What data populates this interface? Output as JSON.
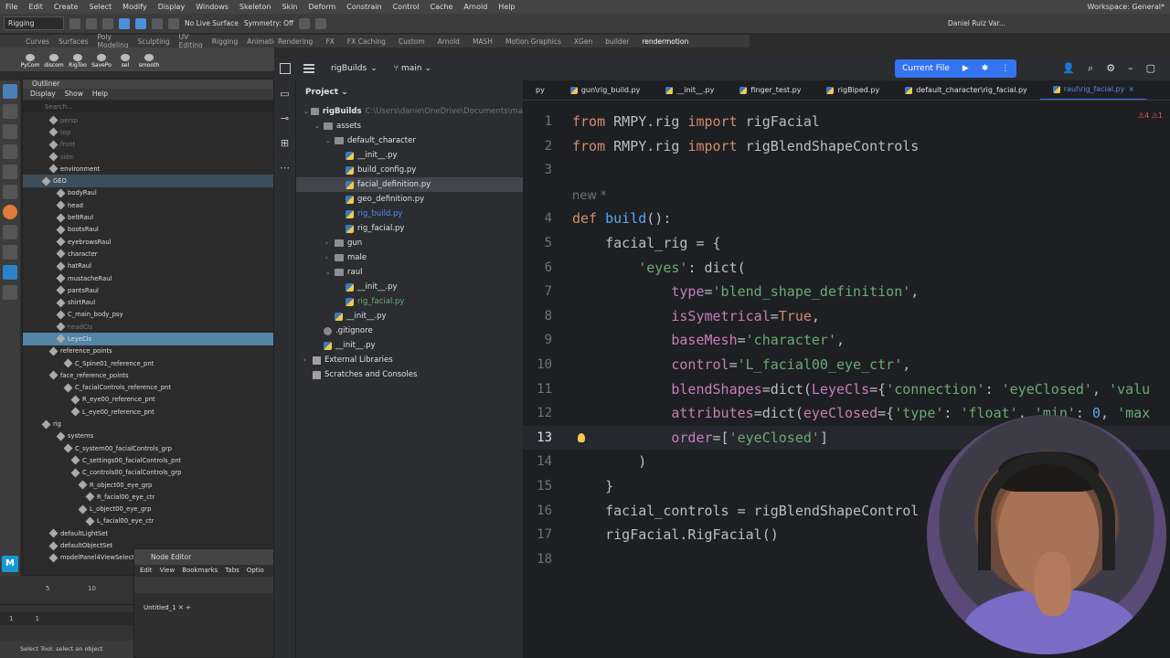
{
  "maya": {
    "menu": [
      "File",
      "Edit",
      "Create",
      "Select",
      "Modify",
      "Display",
      "Windows",
      "Skeleton",
      "Skin",
      "Deform",
      "Constrain",
      "Control",
      "Cache",
      "Arnold",
      "Help"
    ],
    "workspace": "Workspace: General*",
    "toolbar": {
      "mode": "Rigging",
      "live_surface": "No Live Surface",
      "symmetry": "Symmetry: Off",
      "user": "Daniel Ruiz Var..."
    },
    "shelf_tabs": [
      "Curves",
      "Surfaces",
      "Poly Modeling",
      "Sculpting",
      "UV Editing",
      "Rigging",
      "Animation",
      "Rendering",
      "FX",
      "FX Caching",
      "Custom",
      "Arnold",
      "MASH",
      "Motion Graphics",
      "XGen",
      "builder",
      "rendermotion"
    ],
    "shelf_buttons": [
      "PyCom",
      "discom",
      "RigToo",
      "SavePo",
      "sel",
      "smooth"
    ],
    "outliner": {
      "title": "Outliner",
      "menu": [
        "Display",
        "Show",
        "Help"
      ],
      "search_placeholder": "Search...",
      "rows": [
        {
          "label": "persp",
          "dim": true,
          "indent": 3
        },
        {
          "label": "top",
          "dim": true,
          "indent": 3
        },
        {
          "label": "front",
          "dim": true,
          "indent": 3
        },
        {
          "label": "side",
          "dim": true,
          "indent": 3
        },
        {
          "label": "environment",
          "indent": 3
        },
        {
          "label": "GEO",
          "indent": 2,
          "hl": true
        },
        {
          "label": "bodyRaul",
          "indent": 4
        },
        {
          "label": "head",
          "indent": 4
        },
        {
          "label": "beltRaul",
          "indent": 4
        },
        {
          "label": "bootsRaul",
          "indent": 4
        },
        {
          "label": "eyebrowsRaul",
          "indent": 4
        },
        {
          "label": "character",
          "indent": 4
        },
        {
          "label": "hatRaul",
          "indent": 4
        },
        {
          "label": "mustacheRaul",
          "indent": 4
        },
        {
          "label": "pantsRaul",
          "indent": 4
        },
        {
          "label": "shirtRaul",
          "indent": 4
        },
        {
          "label": "C_main_body_psy",
          "indent": 4
        },
        {
          "label": "headCls",
          "dim": true,
          "indent": 4
        },
        {
          "label": "LeyeCls",
          "indent": 4,
          "sel": true
        },
        {
          "label": "reference_points",
          "indent": 3
        },
        {
          "label": "C_Spine01_reference_pnt",
          "indent": 5
        },
        {
          "label": "face_reference_points",
          "indent": 3
        },
        {
          "label": "C_facialControls_reference_pnt",
          "indent": 5
        },
        {
          "label": "R_eye00_reference_pnt",
          "indent": 6
        },
        {
          "label": "L_eye00_reference_pnt",
          "indent": 6
        },
        {
          "label": "rig",
          "indent": 2
        },
        {
          "label": "systems",
          "indent": 4
        },
        {
          "label": "C_system00_facialControls_grp",
          "indent": 5
        },
        {
          "label": "C_settings00_facialControls_pnt",
          "indent": 6
        },
        {
          "label": "C_controls00_facialControls_grp",
          "indent": 6
        },
        {
          "label": "R_object00_eye_grp",
          "indent": 7
        },
        {
          "label": "R_facial00_eye_ctr",
          "indent": 8
        },
        {
          "label": "L_object00_eye_grp",
          "indent": 7
        },
        {
          "label": "L_facial00_eye_ctr",
          "indent": 8
        },
        {
          "label": "defaultLightSet",
          "indent": 3
        },
        {
          "label": "defaultObjectSet",
          "indent": 3
        },
        {
          "label": "modelPanel4ViewSelect...",
          "indent": 3
        }
      ]
    },
    "node_editor": {
      "title": "Node Editor",
      "menu": [
        "Edit",
        "View",
        "Bookmarks",
        "Tabs",
        "Optio"
      ],
      "tab": "Untitled_1"
    },
    "timeline": {
      "ticks": [
        "5",
        "10"
      ],
      "range_start": "1",
      "range_value": "1"
    },
    "status": "Select Tool: select an object",
    "badge": "M"
  },
  "ide": {
    "project_name": "rigBuilds",
    "branch": "main",
    "run_config": "Current File",
    "panel_title": "Project",
    "tree": [
      {
        "label": "rigBuilds",
        "path": "C:\\Users\\danie\\OneDrive\\Documents\\ma",
        "type": "folder",
        "indent": 0,
        "open": true
      },
      {
        "label": "assets",
        "type": "folder",
        "indent": 1,
        "open": true
      },
      {
        "label": "default_character",
        "type": "folder",
        "indent": 2,
        "open": true
      },
      {
        "label": "__init__.py",
        "type": "py",
        "indent": 3
      },
      {
        "label": "build_config.py",
        "type": "py",
        "indent": 3
      },
      {
        "label": "facial_definition.py",
        "type": "py",
        "indent": 3,
        "sel": true
      },
      {
        "label": "geo_definition.py",
        "type": "py",
        "indent": 3
      },
      {
        "label": "rig_build.py",
        "type": "py",
        "indent": 3,
        "color": "blue"
      },
      {
        "label": "rig_facial.py",
        "type": "py",
        "indent": 3
      },
      {
        "label": "gun",
        "type": "folder",
        "indent": 2,
        "open": false
      },
      {
        "label": "male",
        "type": "folder",
        "indent": 2,
        "open": false
      },
      {
        "label": "raul",
        "type": "folder",
        "indent": 2,
        "open": true
      },
      {
        "label": "__init__.py",
        "type": "py",
        "indent": 3
      },
      {
        "label": "rig_facial.py",
        "type": "py",
        "indent": 3,
        "color": "green"
      },
      {
        "label": "__init__.py",
        "type": "py",
        "indent": 2
      },
      {
        "label": ".gitignore",
        "type": "git",
        "indent": 1
      },
      {
        "label": "__init__.py",
        "type": "py",
        "indent": 1
      },
      {
        "label": "External Libraries",
        "type": "lib",
        "indent": 0,
        "open": false
      },
      {
        "label": "Scratches and Consoles",
        "type": "lib",
        "indent": 0
      }
    ],
    "tabs": [
      {
        "label": "py"
      },
      {
        "label": "gun\\rig_build.py"
      },
      {
        "label": "__init__.py"
      },
      {
        "label": "finger_test.py"
      },
      {
        "label": "rigBiped.py"
      },
      {
        "label": "default_character\\rig_facial.py"
      },
      {
        "label": "raul\\rig_facial.py",
        "active": true
      }
    ],
    "warnings": "⚠4 ⚠1",
    "code_lines": [
      {
        "n": "1",
        "html": "<span class='kw'>from</span> RMPY.rig <span class='kw'>import</span> rigFacial"
      },
      {
        "n": "2",
        "html": "<span class='kw'>from</span> RMPY.rig <span class='kw'>import</span> rigBlendShapeControls"
      },
      {
        "n": "3",
        "html": ""
      },
      {
        "n": "",
        "html": "<span class='ann'>new *</span>"
      },
      {
        "n": "4",
        "html": "<span class='kw'>def</span> <span class='fn'>build</span>():"
      },
      {
        "n": "5",
        "html": "    facial_rig = {"
      },
      {
        "n": "6",
        "html": "        <span class='str'>'eyes'</span>: dict("
      },
      {
        "n": "7",
        "html": "            <span class='param'>type</span>=<span class='str'>'blend_shape_definition'</span>,"
      },
      {
        "n": "8",
        "html": "            <span class='param'>isSymetrical</span>=<span class='kw'>True</span>,"
      },
      {
        "n": "9",
        "html": "            <span class='param'>baseMesh</span>=<span class='str'>'character'</span>,"
      },
      {
        "n": "10",
        "html": "            <span class='param'>control</span>=<span class='str'>'L_facial00_eye_ctr'</span>,"
      },
      {
        "n": "11",
        "html": "            <span class='param'>blendShapes</span>=dict(<span class='param'>LeyeCls</span>={<span class='str'>'connection'</span>: <span class='str'>'eyeClosed'</span>, <span class='str'>'valu</span>"
      },
      {
        "n": "12",
        "html": "            <span class='param'>attributes</span>=dict(<span class='param'>eyeClosed</span>={<span class='str'>'type'</span>: <span class='str'>'float'</span>, <span class='str'>'min'</span>: <span class='fn'>0</span>, <span class='str'>'max</span>"
      },
      {
        "n": "13",
        "html": "            <span class='param'>order</span>=[<span class='str'>'eyeClosed'</span>]",
        "caret": true
      },
      {
        "n": "14",
        "html": "        )"
      },
      {
        "n": "15",
        "html": "    }"
      },
      {
        "n": "16",
        "html": "    facial_controls = rigBlendShapeControl"
      },
      {
        "n": "17",
        "html": "    rigFacial.RigFacial()"
      },
      {
        "n": "18",
        "html": ""
      }
    ]
  },
  "colors": {
    "accent": "#3574f0",
    "keyword": "#cf8e6d",
    "string": "#6aab73",
    "param": "#c77dbb",
    "function": "#56a8f5"
  }
}
